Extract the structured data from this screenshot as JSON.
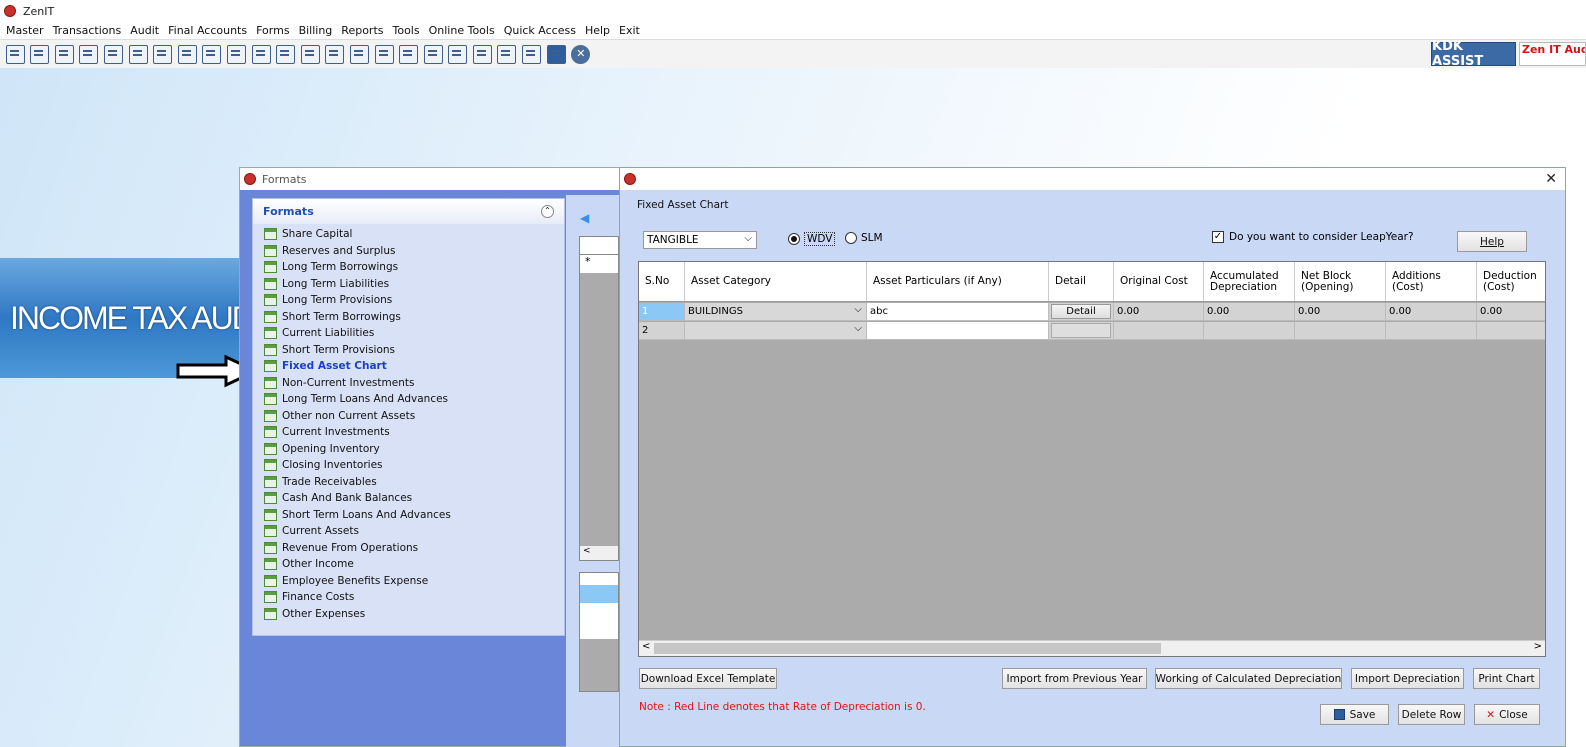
{
  "app": {
    "title": "ZenIT"
  },
  "menu": [
    "Master",
    "Transactions",
    "Audit",
    "Final Accounts",
    "Forms",
    "Billing",
    "Reports",
    "Tools",
    "Online Tools",
    "Quick Access",
    "Help",
    "Exit"
  ],
  "toolbar": {
    "icons": [
      "register-icon",
      "home-icon",
      "building-icon",
      "bar-chart-icon",
      "gift-icon",
      "users-icon",
      "hammer-icon",
      "filter-icon",
      "tax-icon",
      "refresh-icon",
      "calculator-icon",
      "pie-chart-icon",
      "pay-icon",
      "book-icon",
      "info-icon",
      "report-icon",
      "edit-doc-icon",
      "calendar-icon",
      "folder-add-icon",
      "bs-icon",
      "3cd-icon",
      "document-icon",
      "fac-icon",
      "close-icon"
    ],
    "kdk_label": "KDK ASSIST",
    "zen_auditor_label": "Zen IT Audito"
  },
  "banner": {
    "text": "INCOME TAX AUD"
  },
  "formats_window": {
    "title": "Formats",
    "panel_title": "Formats",
    "items": [
      "Share Capital",
      "Reserves and Surplus",
      "Long Term Borrowings",
      "Long Term Liabilities",
      "Long Term Provisions",
      "Short Term Borrowings",
      "Current Liabilities",
      "Short Term Provisions",
      "Fixed Asset Chart",
      "Non-Current Investments",
      "Long Term Loans And Advances",
      "Other non Current Assets",
      "Current Investments",
      "Opening Inventory",
      "Closing Inventories",
      "Trade Receivables",
      "Cash And Bank Balances",
      "Short Term Loans And Advances",
      "Current Assets",
      "Revenue From Operations",
      "Other Income",
      "Employee Benefits Expense",
      "Finance Costs",
      "Other Expenses"
    ],
    "active_item": "Fixed Asset Chart"
  },
  "fixed_asset": {
    "section_title": "Fixed Asset Chart",
    "asset_type": "TANGIBLE",
    "method_wdv": "WDV",
    "method_slm": "SLM",
    "selected_method": "WDV",
    "leapyear_label": "Do you want to consider LeapYear?",
    "leapyear_checked": true,
    "help_label": "Help",
    "columns": [
      "S.No",
      "Asset Category",
      "Asset Particulars (if Any)",
      "Detail",
      "Original Cost",
      "Accumulated Depreciation",
      "Net Block (Opening)",
      "Additions (Cost)",
      "Deduction (Cost)"
    ],
    "rows": [
      {
        "sno": "1",
        "category": "BUILDINGS",
        "particulars": "abc",
        "detail": "Detail",
        "original_cost": "0.00",
        "acc_dep": "0.00",
        "net_block": "0.00",
        "additions": "0.00",
        "deduction": "0.00"
      },
      {
        "sno": "2",
        "category": "",
        "particulars": "",
        "detail": "",
        "original_cost": "",
        "acc_dep": "",
        "net_block": "",
        "additions": "",
        "deduction": ""
      }
    ],
    "buttons": {
      "download_template": "Download Excel Template",
      "import_prev_year": "Import from Previous Year",
      "working_calc_dep": "Working of Calculated Depreciation",
      "import_dep": "Import Depreciation",
      "print_chart": "Print Chart",
      "save": "Save",
      "delete_row": "Delete Row",
      "close": "Close"
    },
    "note": "Note : Red Line denotes that Rate of Depreciation is 0."
  },
  "colors": {
    "accent": "#3b6aa5",
    "note_red": "#e01414",
    "active_item": "#1a3fc8"
  }
}
